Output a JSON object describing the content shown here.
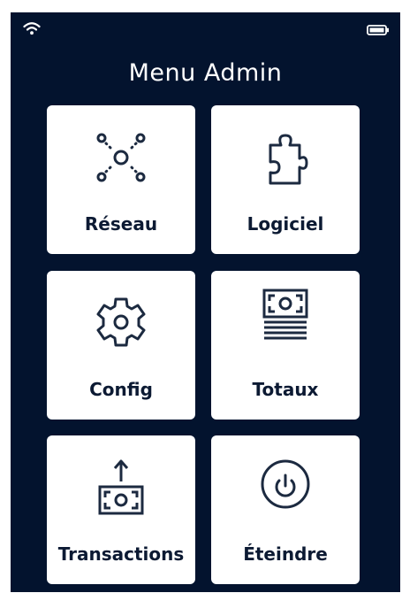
{
  "status_bar": {
    "wifi_icon": "wifi-icon",
    "battery_icon": "battery-icon"
  },
  "title": "Menu Admin",
  "colors": {
    "background": "#03132e",
    "tile": "#ffffff",
    "icon": "#1c2a40",
    "label": "#0c1a33"
  },
  "tiles": [
    {
      "label": "Réseau",
      "icon": "network-icon"
    },
    {
      "label": "Logiciel",
      "icon": "puzzle-icon"
    },
    {
      "label": "Config",
      "icon": "gear-icon"
    },
    {
      "label": "Totaux",
      "icon": "cash-stack-icon"
    },
    {
      "label": "Transactions",
      "icon": "cash-upload-icon"
    },
    {
      "label": "Éteindre",
      "icon": "power-icon"
    }
  ]
}
